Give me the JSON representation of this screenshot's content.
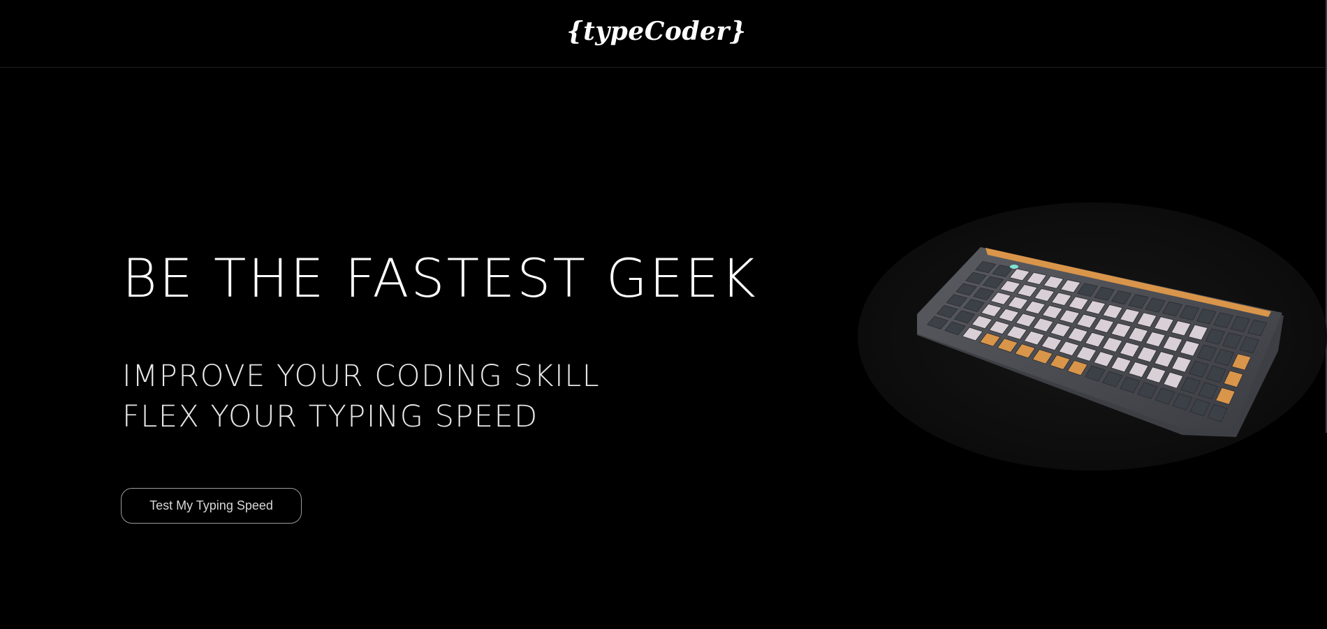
{
  "header": {
    "logo": "{typeCoder}"
  },
  "hero": {
    "title": "BE THE FASTEST GEEK",
    "subtitle_lines": [
      "IMPROVE YOUR CODING SKILL",
      "FLEX YOUR TYPING SPEED"
    ],
    "cta_label": "Test My Typing Speed"
  },
  "colors": {
    "background": "#000000",
    "text": "#ffffff",
    "cta_border": "#9c9c9c",
    "keycap_light": "#d9cfd6",
    "keycap_dark": "#3c4148",
    "keycap_accent": "#d9954a"
  },
  "icons": {
    "product_image": "mechanical-keyboard"
  }
}
